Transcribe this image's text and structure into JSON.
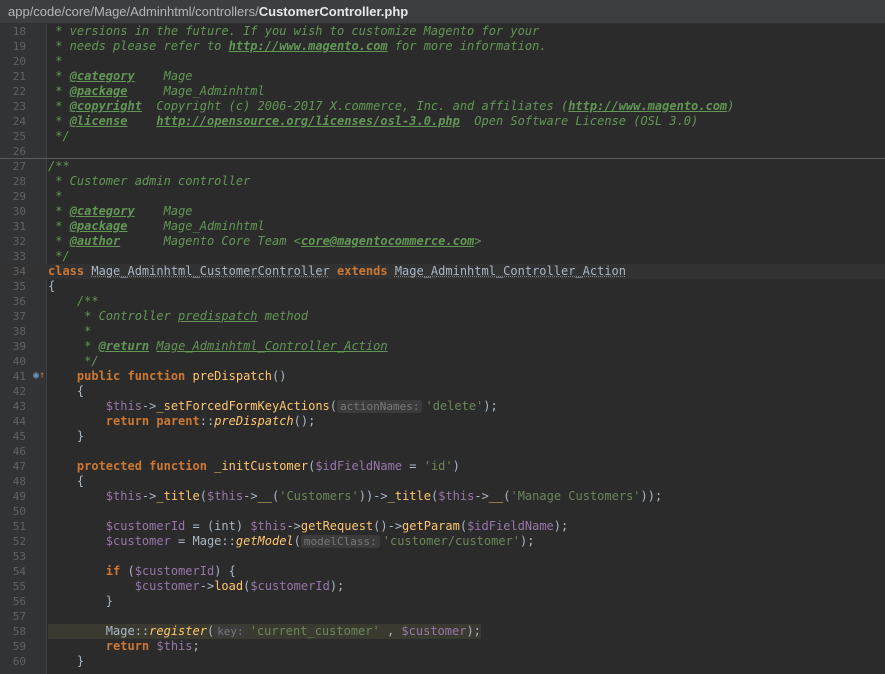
{
  "breadcrumb": {
    "path": "app/code/core/Mage/Adminhtml/controllers/",
    "file": "CustomerController.php"
  },
  "lines": [
    {
      "n": "18",
      "segs": [
        [
          "c-doc",
          " * versions in the future. If you wish to customize Magento for your"
        ]
      ]
    },
    {
      "n": "19",
      "segs": [
        [
          "c-doc",
          " * needs please refer to "
        ],
        [
          "c-link",
          "http://www.magento.com"
        ],
        [
          "c-doc",
          " for more information."
        ]
      ]
    },
    {
      "n": "20",
      "segs": [
        [
          "c-doc",
          " *"
        ]
      ]
    },
    {
      "n": "21",
      "segs": [
        [
          "c-doc",
          " * "
        ],
        [
          "c-tag",
          "@category"
        ],
        [
          "c-doc",
          "    Mage"
        ]
      ]
    },
    {
      "n": "22",
      "segs": [
        [
          "c-doc",
          " * "
        ],
        [
          "c-tag",
          "@package"
        ],
        [
          "c-doc",
          "     Mage_Adminhtml"
        ]
      ]
    },
    {
      "n": "23",
      "segs": [
        [
          "c-doc",
          " * "
        ],
        [
          "c-tag",
          "@copyright"
        ],
        [
          "c-doc",
          "  Copyright (c) 2006-2017 X.commerce, Inc. and affiliates ("
        ],
        [
          "c-link",
          "http://www.magento.com"
        ],
        [
          "c-doc",
          ")"
        ]
      ]
    },
    {
      "n": "24",
      "segs": [
        [
          "c-doc",
          " * "
        ],
        [
          "c-tag",
          "@license"
        ],
        [
          "c-doc",
          "    "
        ],
        [
          "c-link",
          "http://opensource.org/licenses/osl-3.0.php"
        ],
        [
          "c-doc",
          "  Open Software License (OSL 3.0)"
        ]
      ]
    },
    {
      "n": "25",
      "segs": [
        [
          "c-doc",
          " */"
        ]
      ]
    },
    {
      "n": "26",
      "segs": [],
      "sep": true
    },
    {
      "n": "27",
      "segs": [
        [
          "c-doc",
          "/**"
        ]
      ]
    },
    {
      "n": "28",
      "segs": [
        [
          "c-doc",
          " * Customer admin controller"
        ]
      ]
    },
    {
      "n": "29",
      "segs": [
        [
          "c-doc",
          " *"
        ]
      ]
    },
    {
      "n": "30",
      "segs": [
        [
          "c-doc",
          " * "
        ],
        [
          "c-tag",
          "@category"
        ],
        [
          "c-doc",
          "    Mage"
        ]
      ]
    },
    {
      "n": "31",
      "segs": [
        [
          "c-doc",
          " * "
        ],
        [
          "c-tag",
          "@package"
        ],
        [
          "c-doc",
          "     Mage_Adminhtml"
        ]
      ]
    },
    {
      "n": "32",
      "segs": [
        [
          "c-doc",
          " * "
        ],
        [
          "c-tag",
          "@author"
        ],
        [
          "c-doc",
          "      Magento Core Team <"
        ],
        [
          "c-link",
          "core@magentocommerce.com"
        ],
        [
          "c-doc",
          ">"
        ]
      ]
    },
    {
      "n": "33",
      "segs": [
        [
          "c-doc",
          " */"
        ]
      ]
    },
    {
      "n": "34",
      "hl": true,
      "segs": [
        [
          "kw",
          "class "
        ],
        [
          "cls",
          "Mage_Adminhtml_CustomerController"
        ],
        [
          "kw",
          " extends "
        ],
        [
          "cls",
          "Mage_Adminhtml_Controller_Action"
        ]
      ]
    },
    {
      "n": "35",
      "segs": [
        [
          "",
          "{"
        ]
      ]
    },
    {
      "n": "36",
      "segs": [
        [
          "c-doc",
          "    /**"
        ]
      ]
    },
    {
      "n": "37",
      "segs": [
        [
          "c-doc",
          "     * Controller "
        ],
        [
          "c-ref",
          "predispatch"
        ],
        [
          "c-doc",
          " method"
        ]
      ]
    },
    {
      "n": "38",
      "segs": [
        [
          "c-doc",
          "     *"
        ]
      ]
    },
    {
      "n": "39",
      "segs": [
        [
          "c-doc",
          "     * "
        ],
        [
          "c-tag",
          "@return"
        ],
        [
          "c-doc",
          " "
        ],
        [
          "c-ref",
          "Mage_Adminhtml_Controller_Action"
        ]
      ]
    },
    {
      "n": "40",
      "segs": [
        [
          "c-doc",
          "     */"
        ]
      ]
    },
    {
      "n": "41",
      "marker": true,
      "segs": [
        [
          "kw",
          "    public function "
        ],
        [
          "fn",
          "preDispatch"
        ],
        [
          "",
          "()"
        ]
      ]
    },
    {
      "n": "42",
      "segs": [
        [
          "",
          "    {"
        ]
      ]
    },
    {
      "n": "43",
      "segs": [
        [
          "",
          "        "
        ],
        [
          "var",
          "$this"
        ],
        [
          "",
          "->"
        ],
        [
          "fn",
          "_setForcedFormKeyActions"
        ],
        [
          "",
          "("
        ],
        [
          "hint",
          "actionNames:"
        ],
        [
          "str",
          "'delete'"
        ],
        [
          "",
          ");"
        ]
      ]
    },
    {
      "n": "44",
      "segs": [
        [
          "kw",
          "        return "
        ],
        [
          "kw",
          "parent"
        ],
        [
          "",
          "::"
        ],
        [
          "fni",
          "preDispatch"
        ],
        [
          "",
          "();"
        ]
      ]
    },
    {
      "n": "45",
      "segs": [
        [
          "",
          "    }"
        ]
      ]
    },
    {
      "n": "46",
      "segs": []
    },
    {
      "n": "47",
      "segs": [
        [
          "kw",
          "    protected function "
        ],
        [
          "fn",
          "_initCustomer"
        ],
        [
          "",
          "("
        ],
        [
          "var",
          "$idFieldName"
        ],
        [
          "",
          " = "
        ],
        [
          "str",
          "'id'"
        ],
        [
          "",
          ")"
        ]
      ]
    },
    {
      "n": "48",
      "segs": [
        [
          "",
          "    {"
        ]
      ]
    },
    {
      "n": "49",
      "segs": [
        [
          "",
          "        "
        ],
        [
          "var",
          "$this"
        ],
        [
          "",
          "->"
        ],
        [
          "fn",
          "_title"
        ],
        [
          "",
          "("
        ],
        [
          "var",
          "$this"
        ],
        [
          "",
          "->"
        ],
        [
          "fn",
          "__"
        ],
        [
          "",
          "("
        ],
        [
          "str",
          "'Customers'"
        ],
        [
          "",
          "))->"
        ],
        [
          "fn",
          "_title"
        ],
        [
          "",
          "("
        ],
        [
          "var",
          "$this"
        ],
        [
          "",
          "->"
        ],
        [
          "fn",
          "__"
        ],
        [
          "",
          "("
        ],
        [
          "str",
          "'Manage Customers'"
        ],
        [
          "",
          "));"
        ]
      ]
    },
    {
      "n": "50",
      "segs": []
    },
    {
      "n": "51",
      "segs": [
        [
          "",
          "        "
        ],
        [
          "var",
          "$customerId"
        ],
        [
          "",
          " = (int) "
        ],
        [
          "var",
          "$this"
        ],
        [
          "",
          "->"
        ],
        [
          "fn",
          "getRequest"
        ],
        [
          "",
          "()->"
        ],
        [
          "fn",
          "getParam"
        ],
        [
          "",
          "("
        ],
        [
          "var",
          "$idFieldName"
        ],
        [
          "",
          ");"
        ]
      ]
    },
    {
      "n": "52",
      "segs": [
        [
          "",
          "        "
        ],
        [
          "var",
          "$customer"
        ],
        [
          "",
          " = Mage::"
        ],
        [
          "fni",
          "getModel"
        ],
        [
          "",
          "("
        ],
        [
          "hint",
          "modelClass:"
        ],
        [
          "str",
          "'customer/customer'"
        ],
        [
          "",
          ");"
        ]
      ]
    },
    {
      "n": "53",
      "segs": []
    },
    {
      "n": "54",
      "segs": [
        [
          "kw",
          "        if "
        ],
        [
          "",
          "("
        ],
        [
          "var",
          "$customerId"
        ],
        [
          "",
          ") {"
        ]
      ]
    },
    {
      "n": "55",
      "segs": [
        [
          "",
          "            "
        ],
        [
          "var",
          "$customer"
        ],
        [
          "",
          "->"
        ],
        [
          "fn",
          "load"
        ],
        [
          "",
          "("
        ],
        [
          "var",
          "$customerId"
        ],
        [
          "",
          ");"
        ]
      ]
    },
    {
      "n": "56",
      "segs": [
        [
          "",
          "        }"
        ]
      ]
    },
    {
      "n": "57",
      "segs": []
    },
    {
      "n": "58",
      "sel": true,
      "segs": [
        [
          "",
          "        Mage::"
        ],
        [
          "fni",
          "register"
        ],
        [
          "",
          "("
        ],
        [
          "hint",
          "key:"
        ],
        [
          "str",
          "'current_customer'"
        ],
        [
          "",
          " , "
        ],
        [
          "var",
          "$customer"
        ],
        [
          "",
          ");"
        ]
      ]
    },
    {
      "n": "59",
      "segs": [
        [
          "kw",
          "        return "
        ],
        [
          "var",
          "$this"
        ],
        [
          "",
          ";"
        ]
      ]
    },
    {
      "n": "60",
      "segs": [
        [
          "",
          "    }"
        ]
      ]
    }
  ]
}
